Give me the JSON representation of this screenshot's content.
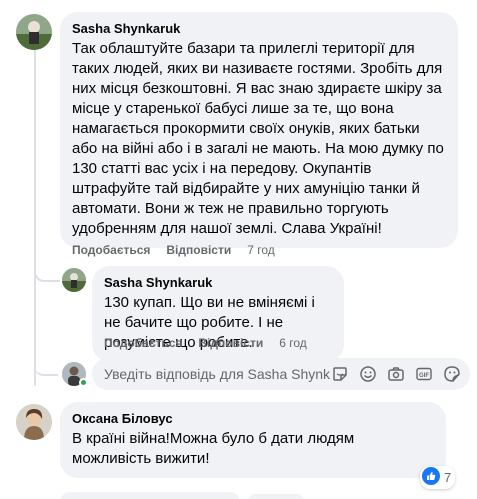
{
  "comments": [
    {
      "author": "Sasha Shynkaruk",
      "text": "Так облаштуйте базари та прилеглі території для таких людей, яких ви називаєте гостями. Зробіть для них місця безкоштовні. Я вас знаю здираєте шкіру за місце у старенької бабусі лише за те, що вона намагається прокормити своїх онуків, яких батьки або на війні або і в загалі не мають. На мою думку по 130 статті вас усіх і на передову. Окупантів штрафуйте тай відбирайте у них амуніцію танки й автомати. Вони ж теж не правильно торгують удобренням для нашої землі. Слава Україні!",
      "like_label": "Подобається",
      "reply_label": "Відповісти",
      "time": "7 год"
    }
  ],
  "reply": {
    "author": "Sasha Shynkaruk",
    "text": "130 купап. Що ви не вміняємі і не бачите що робите. І не розумієте що робите.",
    "like_label": "Подобається",
    "reply_label": "Відповісти",
    "time": "6 год"
  },
  "reply_box": {
    "placeholder": "Уведіть відповідь для Sasha Shynkar…",
    "icons": [
      "sticker-icon",
      "emoji-icon",
      "camera-icon",
      "gif-icon",
      "sticker-face-icon"
    ]
  },
  "second_comment": {
    "author": "Оксана Біловус",
    "text": "В країні війна!Можна було б дати людям можливість вижити!",
    "reaction_count": "7"
  },
  "colors": {
    "bubble": "#f0f2f5",
    "meta_text": "#65676b",
    "like_blue": "#1877f2",
    "online_green": "#31a24c"
  }
}
